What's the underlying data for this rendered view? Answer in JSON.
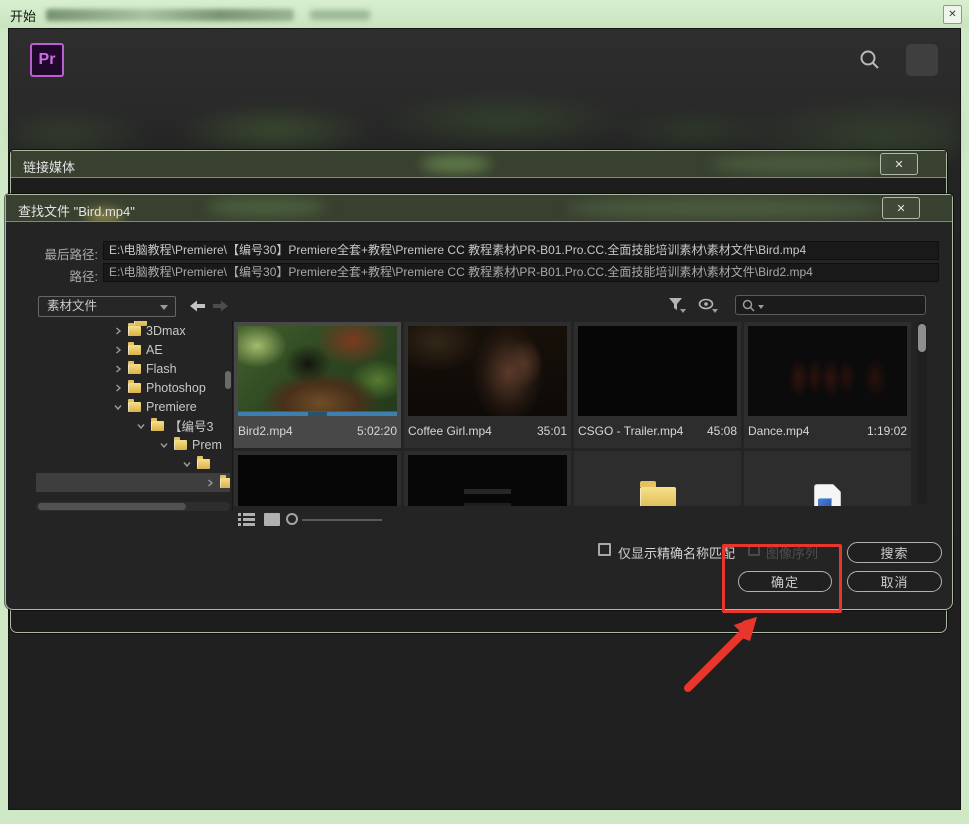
{
  "os": {
    "title": "开始",
    "close_glyph": "✕"
  },
  "header": {
    "logo_text": "Pr"
  },
  "link_dialog": {
    "title": "链接媒体",
    "close_glyph": "✕"
  },
  "find": {
    "title": "查找文件 \"Bird.mp4\"",
    "close_glyph": "✕",
    "last_path_label": "最后路径:",
    "last_path_value": "E:\\电脑教程\\Premiere\\【编号30】Premiere全套+教程\\Premiere  CC 教程素材\\PR-B01.Pro.CC.全面技能培训素材\\素材文件\\Bird.mp4",
    "path_label": "路径:",
    "path_value": "E:\\电脑教程\\Premiere\\【编号30】Premiere全套+教程\\Premiere  CC 教程素材\\PR-B01.Pro.CC.全面技能培训素材\\素材文件\\Bird2.mp4",
    "location_dropdown_value": "素材文件",
    "search_value": "",
    "tree": [
      {
        "label": "3Dmax",
        "state": "collapsed",
        "depth": 0
      },
      {
        "label": "AE",
        "state": "collapsed",
        "depth": 0
      },
      {
        "label": "Flash",
        "state": "collapsed",
        "depth": 0
      },
      {
        "label": "Photoshop",
        "state": "collapsed",
        "depth": 0
      },
      {
        "label": "Premiere",
        "state": "expanded",
        "depth": 0
      },
      {
        "label": "【编号3",
        "state": "expanded",
        "depth": 1
      },
      {
        "label": "Prem",
        "state": "expanded",
        "depth": 2
      },
      {
        "label": "",
        "state": "expanded",
        "depth": 3
      },
      {
        "label": "",
        "state": "collapsed",
        "depth": 4,
        "selected": true
      }
    ],
    "files": [
      {
        "name": "Bird2.mp4",
        "duration": "5:02:20",
        "thumb": "bird",
        "selected": true
      },
      {
        "name": "Coffee Girl.mp4",
        "duration": "35:01",
        "thumb": "coffee"
      },
      {
        "name": "CSGO - Trailer.mp4",
        "duration": "45:08",
        "thumb": "black"
      },
      {
        "name": "Dance.mp4",
        "duration": "1:19:02",
        "thumb": "dance"
      }
    ],
    "files_row2": [
      {
        "thumb": "black"
      },
      {
        "thumb": "black2"
      },
      {
        "icon": "folder"
      },
      {
        "icon": "media-file"
      }
    ],
    "exact_match_label": "仅显示精确名称匹配",
    "image_sequence_label": "图像序列",
    "search_button": "搜索",
    "ok_button": "确定",
    "cancel_button": "取消"
  },
  "colors": {
    "annotation": "#e8362d",
    "scrub_blue": "#3d7fae",
    "folder_yellow": "#e9c45a"
  }
}
